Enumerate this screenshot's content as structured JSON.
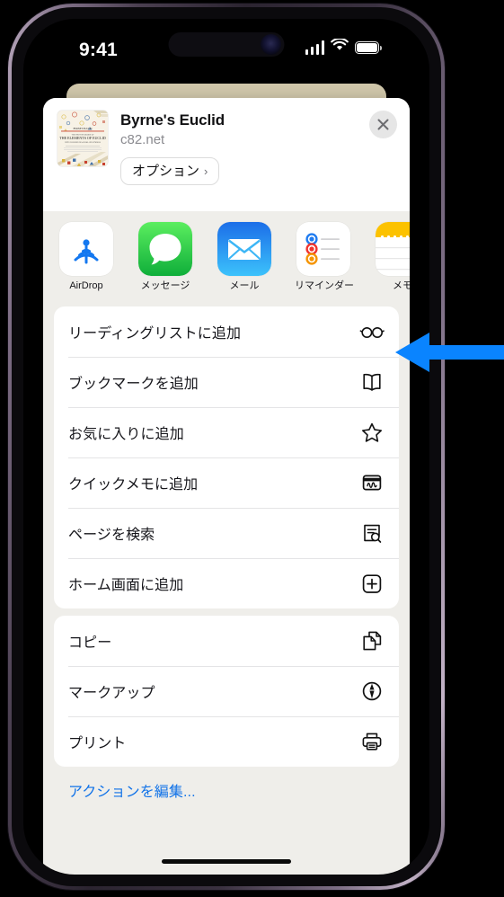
{
  "status_bar": {
    "time": "9:41",
    "cellular_icon": "signal-bars-icon",
    "wifi_icon": "wifi-icon",
    "battery_icon": "battery-icon"
  },
  "share_sheet": {
    "header": {
      "thumbnail_alt": "Byrne's Euclid book cover",
      "thumbnail_caption_top": "BYRNE'S EUCLID",
      "thumbnail_caption_main": "THE ELEMENTS OF EUCLID",
      "title": "Byrne's Euclid",
      "url": "c82.net",
      "options_label": "オプション",
      "options_chevron": "›",
      "close_icon": "close-icon"
    },
    "apps": [
      {
        "label": "AirDrop",
        "icon": "airdrop-icon"
      },
      {
        "label": "メッセージ",
        "icon": "messages-icon"
      },
      {
        "label": "メール",
        "icon": "mail-icon"
      },
      {
        "label": "リマインダー",
        "icon": "reminders-icon"
      },
      {
        "label": "メモ",
        "icon": "notes-icon"
      }
    ],
    "groups": [
      {
        "rows": [
          {
            "label": "リーディングリストに追加",
            "icon": "glasses-icon"
          },
          {
            "label": "ブックマークを追加",
            "icon": "book-icon"
          },
          {
            "label": "お気に入りに追加",
            "icon": "star-icon"
          },
          {
            "label": "クイックメモに追加",
            "icon": "quick-note-icon"
          },
          {
            "label": "ページを検索",
            "icon": "find-on-page-icon"
          },
          {
            "label": "ホーム画面に追加",
            "icon": "add-to-home-screen-icon"
          }
        ]
      },
      {
        "rows": [
          {
            "label": "コピー",
            "icon": "copy-icon"
          },
          {
            "label": "マークアップ",
            "icon": "markup-icon"
          },
          {
            "label": "プリント",
            "icon": "print-icon"
          }
        ]
      }
    ],
    "edit_actions_label": "アクションを編集..."
  },
  "annotation": {
    "arrow_direction": "left",
    "arrow_color": "#0a84ff",
    "points_at": "リーディングリストに追加"
  },
  "colors": {
    "sheet_background": "#efeeea",
    "card_background": "#ffffff",
    "accent_blue": "#1072e8",
    "annotation_blue": "#0a84ff",
    "page_background": "#cfc6aa"
  }
}
